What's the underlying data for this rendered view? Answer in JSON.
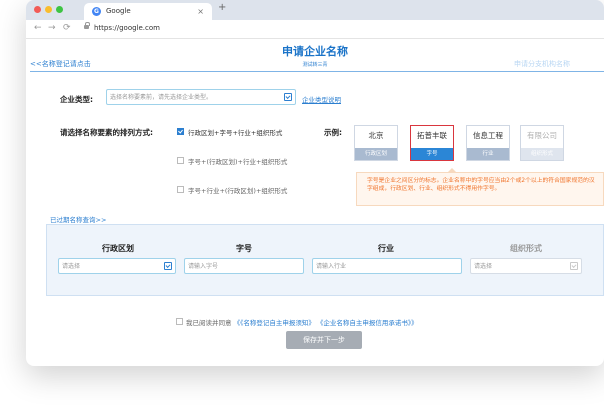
{
  "browser": {
    "tab_title": "Google",
    "tab_close": "×",
    "new_tab": "+",
    "url": "https://google.com",
    "nav": {
      "back": "←",
      "forward": "→",
      "reload": "⟳"
    },
    "dots": [
      "#f25b56",
      "#f9bd2e",
      "#3ec443"
    ]
  },
  "header": {
    "title": "申请企业名称",
    "subtitle": "测试转三青",
    "back_link": "<<名称登记请点击",
    "right_link": "申请分支机构名称"
  },
  "enterprise_type": {
    "label": "企业类型:",
    "placeholder": "选择名称要素前，请先选择企业类型。",
    "help_link": "企业类型说明"
  },
  "arrangement": {
    "label": "请选择名称要素的排列方式:",
    "options": [
      {
        "label": "行政区划+字号+行业+组织形式",
        "checked": true
      },
      {
        "label": "字号+(行政区划)+行业+组织形式",
        "checked": false
      },
      {
        "label": "字号+行业+(行政区划)+组织形式",
        "checked": false
      }
    ]
  },
  "example": {
    "label": "示例:",
    "cards": [
      {
        "top": "北京",
        "bottom": "行政区划"
      },
      {
        "top": "拓普丰联",
        "bottom": "字号"
      },
      {
        "top": "信息工程",
        "bottom": "行业"
      },
      {
        "top": "有限公司",
        "bottom": "组织形式"
      }
    ],
    "tip": "字号是企业之间区分的标志。企业名称中的字号应当由2个或2个以上的符合国家规范的汉字组成，行政区划、行业、组织形式不得用作字号。"
  },
  "elements": {
    "expired_link": "已过期名称查询>>",
    "columns": [
      {
        "header": "行政区划",
        "placeholder": "请选择"
      },
      {
        "header": "字号",
        "placeholder": "请输入字号"
      },
      {
        "header": "行业",
        "placeholder": "请输入行业"
      },
      {
        "header": "组织形式",
        "placeholder": "请选择"
      }
    ]
  },
  "agreement": {
    "prefix": "我已阅读并同意",
    "doc1": "《《名称登记自主申报须知》",
    "doc2": "《企业名称自主申报信用承诺书》》"
  },
  "submit": {
    "label": "保存并下一步"
  }
}
